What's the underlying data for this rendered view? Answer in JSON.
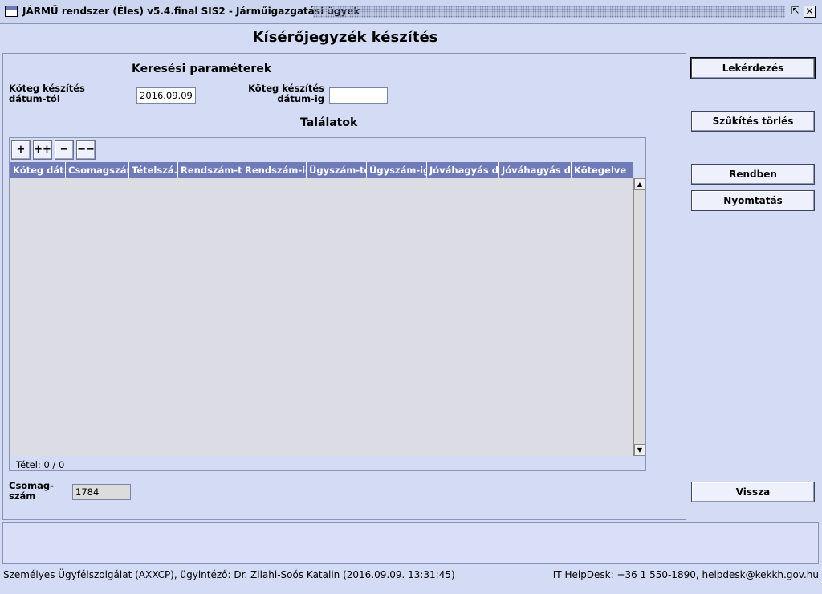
{
  "window": {
    "title": "JÁRMŰ rendszer (Éles) v5.4.final SIS2 - Járműigazgatási ügyek",
    "restore_glyph": "⇱",
    "close_glyph": "✕",
    "icons": {
      "app": "window-icon",
      "restore": "restore-icon",
      "close": "close-icon"
    }
  },
  "page_title": "Kísérőjegyzék készítés",
  "search": {
    "title": "Keresési paraméterek",
    "date_from_label_1": "Köteg készítés",
    "date_from_label_2": "dátum-tól",
    "date_from_value": "2016.09.09.",
    "date_to_label_1": "Köteg készítés",
    "date_to_label_2": "dátum-ig",
    "date_to_value": ""
  },
  "results": {
    "title": "Találatok",
    "toolbar": [
      {
        "name": "expand-icon",
        "glyph": "+"
      },
      {
        "name": "expand-all-icon",
        "glyph": "++"
      },
      {
        "name": "collapse-icon",
        "glyph": "−"
      },
      {
        "name": "collapse-all-icon",
        "glyph": "−−"
      }
    ],
    "columns": [
      "Köteg dát...",
      "Csomagszám",
      "Tételszá...",
      "Rendszám-tól",
      "Rendszám-ig",
      "Ügyszám-tól",
      "Ügyszám-ig",
      "Jóváhagyás d...",
      "Jóváhagyás d...",
      "Kötegelve"
    ],
    "rows": [],
    "status": "Tétel: 0 / 0"
  },
  "package": {
    "label_1": "Csomag-",
    "label_2": "szám",
    "value": "1784"
  },
  "buttons": {
    "query": "Lekérdezés",
    "clear_filter": "Szűkítés törlés",
    "ok": "Rendben",
    "print": "Nyomtatás",
    "back": "Vissza"
  },
  "footer": {
    "left": "Személyes Ügyfélszolgálat (AXXCP), ügyintéző: Dr. Zilahi-Soós Katalin (2016.09.09. 13:31:45)",
    "right": "IT HelpDesk: +36 1 550-1890, helpdesk@kekkh.gov.hu"
  },
  "colors": {
    "background": "#d4dcf5",
    "header": "#6f7bb7",
    "grid": "#dcdde4"
  }
}
